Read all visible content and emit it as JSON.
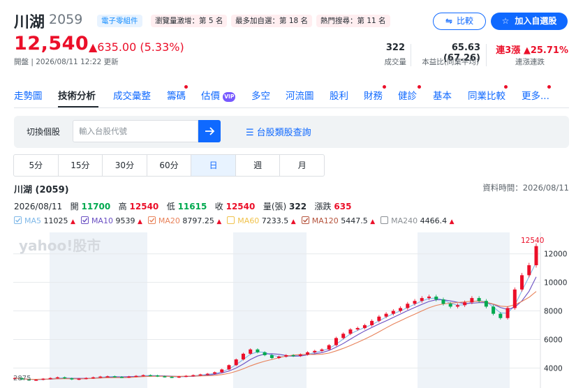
{
  "header": {
    "name": "川湖",
    "code": "2059",
    "category": "電子零組件",
    "badges": [
      "瀏覽量激增：第 5 名",
      "最多加自選：第 18 名",
      "熱門搜尋：第 11 名"
    ],
    "compare_label": "比較",
    "add_label": "加入自選股",
    "price": "12,540",
    "change": "▲635.00 (5.33%)",
    "time_text": "開盤 | 2026/08/11 12:22 更新",
    "volume": "322",
    "volume_label": "成交量",
    "pe": "65.63 (67.26)",
    "pe_label": "本益比(同業平均)",
    "streak": "連3漲",
    "streak_pct": "▲25.71%",
    "streak_label": "連漲連跌"
  },
  "tabs": [
    "走勢圖",
    "技術分析",
    "成交彙整",
    "籌碼",
    "估價",
    "多空",
    "河流圖",
    "股利",
    "財務",
    "健診",
    "基本",
    "同業比較",
    "更多..."
  ],
  "vip_label": "VIP",
  "search": {
    "switch_label": "切換個股",
    "placeholder": "輸入台股代號",
    "category_link": "台股類股查詢"
  },
  "periods": [
    "5分",
    "15分",
    "30分",
    "60分",
    "日",
    "週",
    "月"
  ],
  "active_period": "日",
  "chart_header": {
    "title": "川湖 (2059)",
    "data_time": "資料時間：2026/08/11",
    "date": "2026/08/11",
    "open_label": "開",
    "open": "11700",
    "high_label": "高",
    "high": "12540",
    "low_label": "低",
    "low": "11615",
    "close_label": "收",
    "close": "12540",
    "vol_label": "量(張)",
    "vol": "322",
    "chg_label": "漲跌",
    "chg": "635"
  },
  "ma": [
    {
      "name": "MA5",
      "value": "11025",
      "color": "#7fb8e8"
    },
    {
      "name": "MA10",
      "value": "9539",
      "color": "#6a4fc2"
    },
    {
      "name": "MA20",
      "value": "8797.25",
      "color": "#e8825a"
    },
    {
      "name": "MA60",
      "value": "7233.5",
      "color": "#f0c24b"
    },
    {
      "name": "MA120",
      "value": "5447.5",
      "color": "#b5533c"
    },
    {
      "name": "MA240",
      "value": "4466.4",
      "color": "#8a8f94"
    }
  ],
  "colors": {
    "up": "#eb0f29",
    "down": "#00a94f",
    "accent": "#0f69ff"
  },
  "chart_data": {
    "type": "line",
    "watermark": "yahoo!股市",
    "last_price_label": "12540",
    "min_label": "2875",
    "y_ticks": [
      4000,
      6000,
      8000,
      10000,
      12000
    ],
    "ylim": [
      2600,
      13500
    ],
    "series": [
      {
        "name": "Close",
        "values": [
          3300,
          3200,
          3150,
          3180,
          3250,
          3300,
          3350,
          3280,
          3200,
          3250,
          3300,
          3350,
          3400,
          3420,
          3380,
          3350,
          3400,
          3450,
          3500,
          3480,
          3420,
          3380,
          3350,
          3400,
          3450,
          3500,
          3550,
          3600,
          3700,
          3900,
          4200,
          4600,
          5000,
          5300,
          5100,
          4900,
          4700,
          4800,
          4900,
          4850,
          4950,
          5100,
          5200,
          5300,
          5600,
          6100,
          6400,
          6700,
          6800,
          7000,
          7300,
          7600,
          7800,
          8000,
          8200,
          8500,
          8700,
          8900,
          9000,
          8800,
          8500,
          8300,
          8400,
          8600,
          8900,
          8700,
          8300,
          7800,
          7500,
          8200,
          9500,
          10500,
          11200,
          12540
        ]
      }
    ]
  }
}
